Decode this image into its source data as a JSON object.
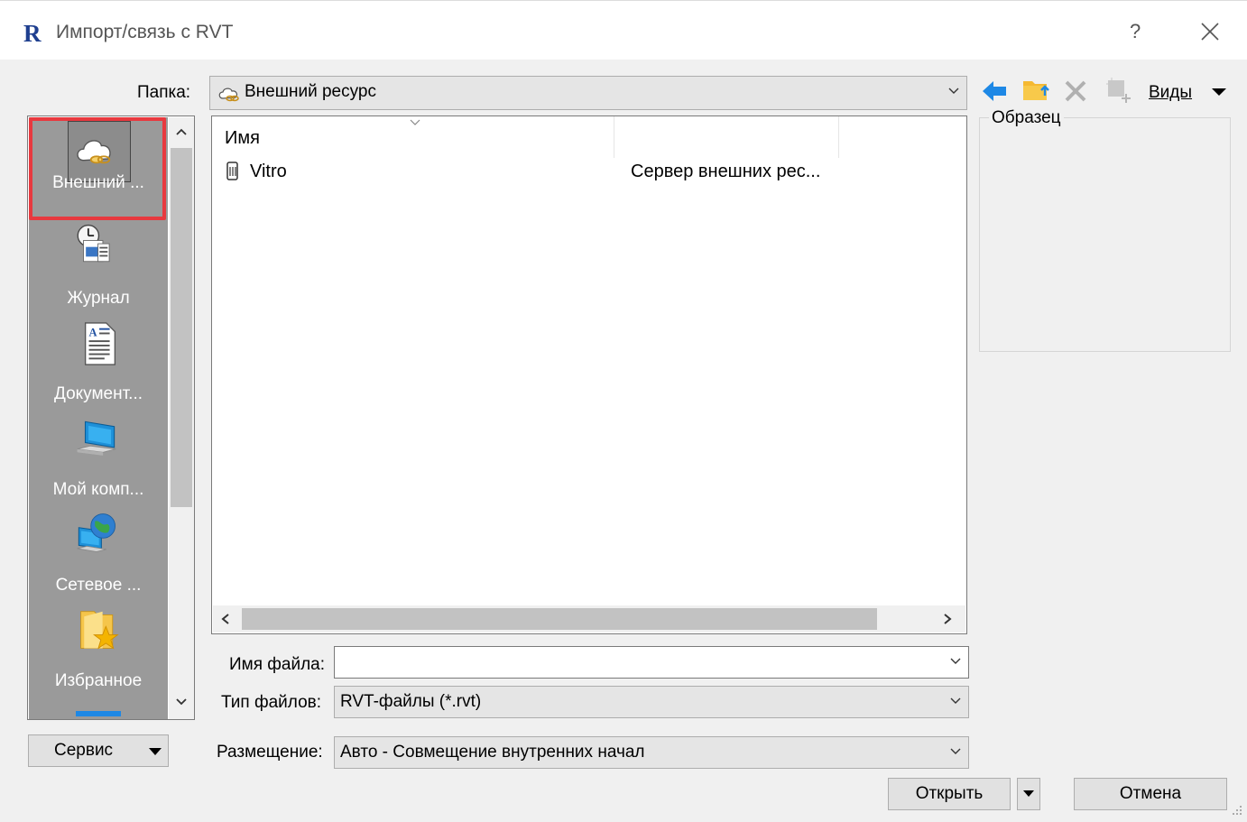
{
  "window": {
    "title": "Импорт/связь с RVT",
    "app_icon": "R",
    "help": "?"
  },
  "folder": {
    "label": "Папка:",
    "value": "Внешний ресурс"
  },
  "toolbar": {
    "views_label": "Виды"
  },
  "places": [
    {
      "label": "Внешний ...",
      "icon": "cloud-link-icon",
      "selected": true
    },
    {
      "label": "Журнал",
      "icon": "history-icon"
    },
    {
      "label": "Документ...",
      "icon": "documents-icon"
    },
    {
      "label": "Мой комп...",
      "icon": "computer-icon"
    },
    {
      "label": "Сетевое ...",
      "icon": "network-icon"
    },
    {
      "label": "Избранное",
      "icon": "favorites-icon"
    }
  ],
  "filelist": {
    "columns": [
      "Имя",
      ""
    ],
    "rows": [
      {
        "name": "Vitro",
        "type": "Сервер внешних рес..."
      }
    ]
  },
  "preview": {
    "label": "Образец"
  },
  "filename": {
    "label": "Имя файла:",
    "value": ""
  },
  "filetype": {
    "label": "Тип файлов:",
    "value": "RVT-файлы  (*.rvt)"
  },
  "placement": {
    "label": "Размещение:",
    "value": "Авто - Совмещение внутренних начал"
  },
  "buttons": {
    "service": "Сервис",
    "open": "Открыть",
    "cancel": "Отмена"
  }
}
